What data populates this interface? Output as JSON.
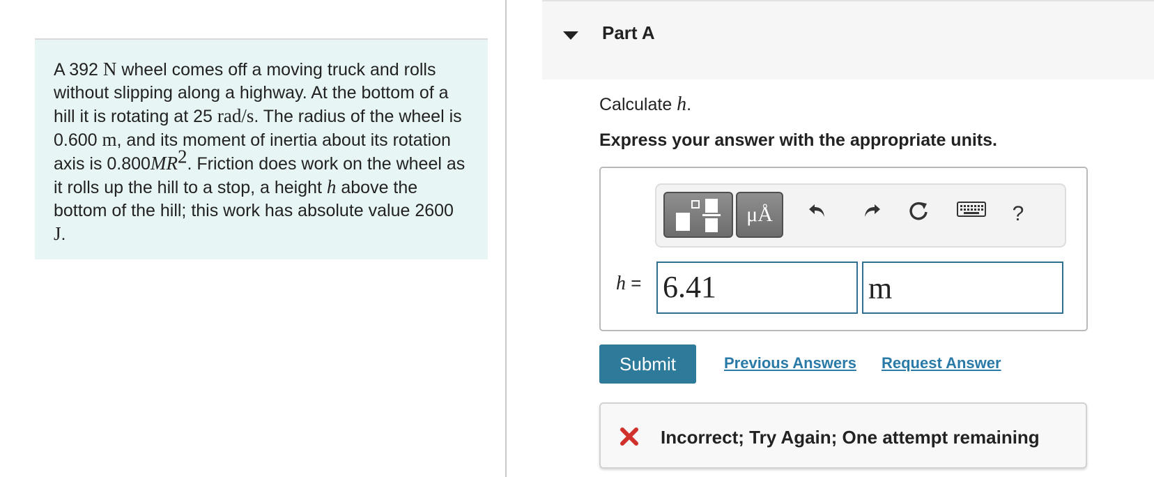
{
  "problem": {
    "t1": "A 392 ",
    "t1_unit": "N",
    "t2": " wheel comes off a moving truck and rolls without slipping along a highway. At the bottom of a hill it is rotating at 25 ",
    "t2_unit": "rad/s",
    "t3": ". The radius of the wheel is 0.600 ",
    "t3_unit": "m",
    "t4": ", and its moment of inertia about its rotation axis is 0.800",
    "t4_var": "MR",
    "t4_sup": "2",
    "t5": ". Friction does work on the wheel as it rolls up the hill to a stop, a height ",
    "t5_var": "h",
    "t6": " above the bottom of the hill; this work has absolute value 2600 ",
    "t6_unit": "J",
    "t7": "."
  },
  "part": {
    "title": "Part A"
  },
  "question": {
    "calc_prefix": "Calculate ",
    "calc_var": "h",
    "calc_suffix": ".",
    "express": "Express your answer with the appropriate units."
  },
  "toolbar": {
    "units_label": "μÅ",
    "help_label": "?",
    "icons": [
      "templates-icon",
      "units-icon",
      "undo-icon",
      "redo-icon",
      "reset-icon",
      "keyboard-icon",
      "help-icon"
    ]
  },
  "answer": {
    "var": "h",
    "eq": " =",
    "value": "6.41",
    "unit": "m"
  },
  "actions": {
    "submit": "Submit",
    "previous_answers": "Previous Answers",
    "request_answer": "Request Answer"
  },
  "feedback": {
    "text": "Incorrect; Try Again; One attempt remaining",
    "color": "#d0312d"
  },
  "colors": {
    "accent": "#2e7a9a",
    "link": "#2a7aa8",
    "problem_bg": "#e8f5f5",
    "input_border": "#2f6f8f"
  }
}
